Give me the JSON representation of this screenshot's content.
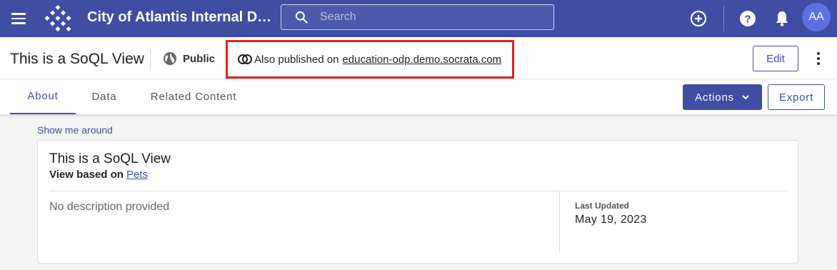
{
  "topbar": {
    "app_title": "City of Atlantis Internal Data",
    "search_placeholder": "Search",
    "avatar_initials": "AA",
    "brand_color": "#3f4ea3"
  },
  "header": {
    "page_title": "This is a SoQL View",
    "visibility": "Public",
    "published_prefix": "Also published on",
    "published_link": "education-odp.demo.socrata.com",
    "edit_label": "Edit"
  },
  "tabs": [
    {
      "label": "About",
      "active": true
    },
    {
      "label": "Data",
      "active": false
    },
    {
      "label": "Related Content",
      "active": false
    }
  ],
  "toolbar": {
    "actions_label": "Actions",
    "export_label": "Export"
  },
  "content": {
    "show_me_around": "Show me around",
    "card_title": "This is a SoQL View",
    "based_on_prefix": "View based on",
    "based_on_link": "Pets",
    "description": "No description provided",
    "last_updated_label": "Last Updated",
    "last_updated_value": "May 19, 2023"
  },
  "icons": {
    "menu": "menu-icon",
    "logo": "logo-icon",
    "search": "search-icon",
    "add": "add-circle-icon",
    "help": "help-icon",
    "notifications": "bell-icon",
    "globe": "globe-icon",
    "published": "linked-circles-icon",
    "more": "more-vert-icon",
    "chevron": "chevron-down-icon"
  },
  "highlight_color": "#e02020"
}
